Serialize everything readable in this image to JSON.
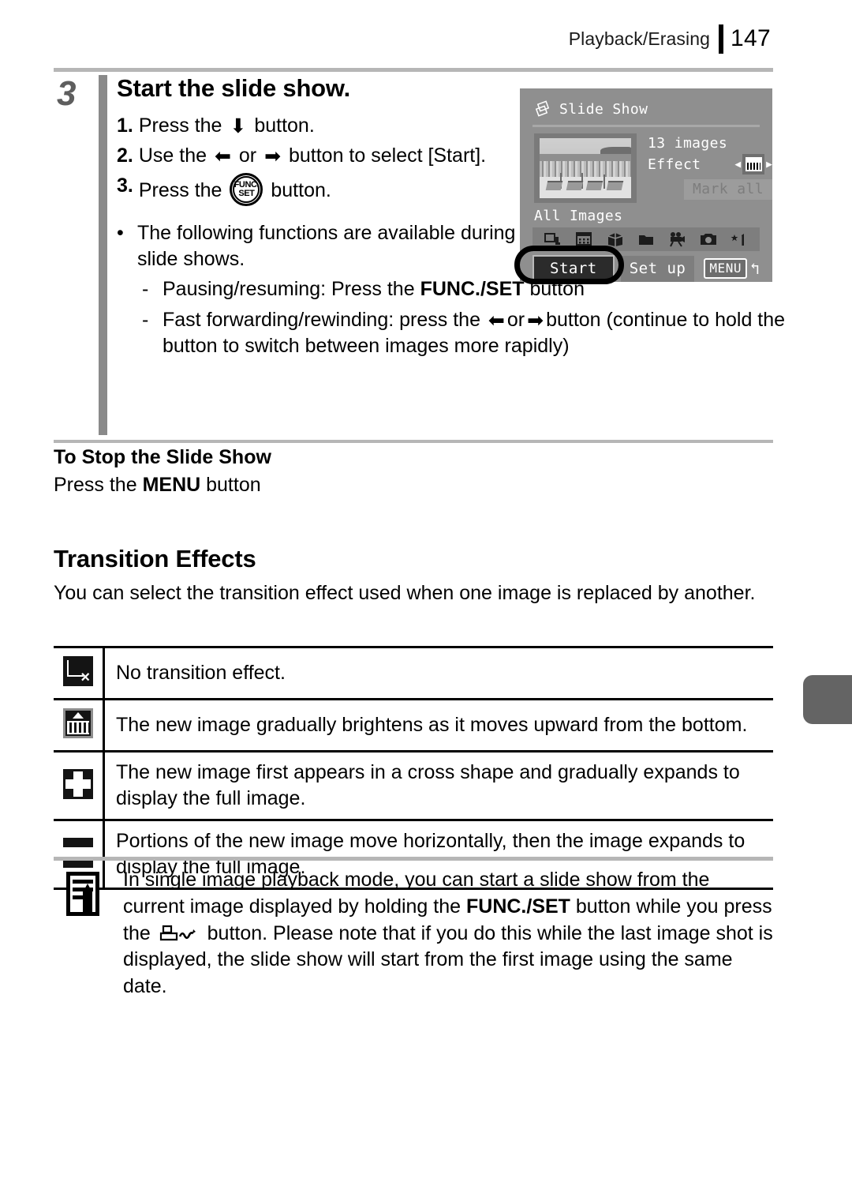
{
  "header": {
    "section_title": "Playback/Erasing",
    "page_number": "147"
  },
  "step": {
    "number": "3",
    "title": "Start the slide show.",
    "substeps": [
      {
        "num": "1.",
        "text_before": "Press the",
        "icon": "down-arrow-button",
        "text_after": "button."
      },
      {
        "num": "2.",
        "text_before": "Use the",
        "icon_left": "left-arrow-button",
        "mid": "or",
        "icon_right": "right-arrow-button",
        "text_after": "button to select [Start]."
      },
      {
        "num": "3.",
        "text_before": "Press the",
        "icon": "func-set-button",
        "text_after": "button."
      }
    ],
    "bullet": {
      "text": "The following functions are available during slide shows.",
      "dashes": [
        {
          "prefix": "Pausing/resuming: Press the ",
          "bold": "FUNC./SET",
          "suffix": " button"
        },
        {
          "prefix": "Fast forwarding/rewinding: press the ",
          "icon_left": "left-arrow-button",
          "mid": "or",
          "icon_right": "right-arrow-button",
          "suffix": "button (continue to hold the button to switch between images more rapidly)"
        }
      ]
    }
  },
  "lcd": {
    "title": "Slide Show",
    "title_icon": "slide-show-icon",
    "images_count": "13 images",
    "effect_label": "Effect",
    "effect_icon": "transition-effect-icon",
    "mark_all": "Mark all",
    "all_images": "All Images",
    "icon_row": [
      "print-order-icon",
      "calendar-icon",
      "package-icon",
      "folder-icon",
      "movie-icon",
      "camera-icon",
      "star-one-icon"
    ],
    "start_button": "Start",
    "setup_button": "Set up",
    "menu_badge": "MENU",
    "return_glyph": "return-icon"
  },
  "stop_section": {
    "title": "To Stop the Slide Show",
    "text_before": "Press the ",
    "bold": "MENU",
    "text_after": " button"
  },
  "transition": {
    "heading": "Transition Effects",
    "intro": "You can select the transition effect used when one image is replaced by another.",
    "rows": [
      {
        "icon": "no-transition-icon",
        "description": "No transition effect."
      },
      {
        "icon": "brighten-upward-icon",
        "description": "The new image gradually brightens as it moves upward from the bottom."
      },
      {
        "icon": "cross-expand-icon",
        "description": "The new image first appears in a cross shape and gradually expands to display the full image."
      },
      {
        "icon": "horizontal-bands-icon",
        "description": "Portions of the new image move horizontally, then the image expands to display the full image."
      }
    ]
  },
  "note": {
    "icon": "note-pencil-icon",
    "part1": "In single image playback mode, you can start a slide show from the current image displayed by holding the ",
    "bold1": "FUNC./SET",
    "part2": " button while you press the ",
    "inline_icon": "print-share-button-icon",
    "part3": " button. Please note that if you do this while the last image shot is displayed, the slide show will start from the first image using the same date."
  },
  "colors": {
    "step_bar": "#8a8a8a",
    "rule": "#b6b6b6",
    "lcd_bg": "#8f8f8f",
    "index_tab": "#646464"
  }
}
